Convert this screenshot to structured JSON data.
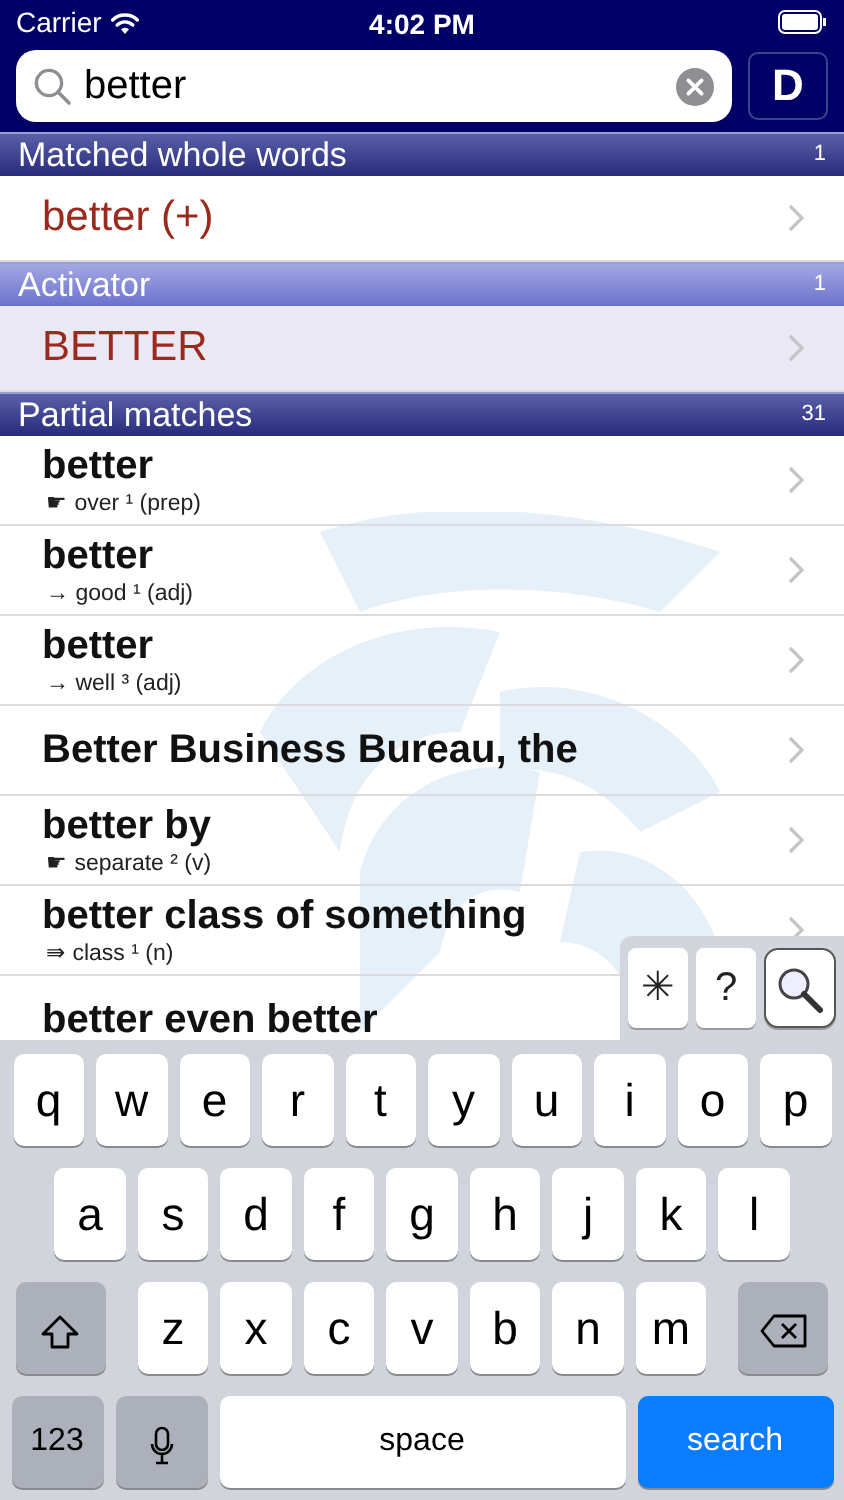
{
  "status_bar": {
    "carrier": "Carrier",
    "time": "4:02 PM"
  },
  "search": {
    "value": "better",
    "button": "D"
  },
  "sections": [
    {
      "title": "Matched whole words",
      "count": "1",
      "kind": "whole",
      "items": [
        {
          "title": "better (+)"
        }
      ]
    },
    {
      "title": "Activator",
      "count": "1",
      "kind": "activator",
      "items": [
        {
          "title": "BETTER"
        }
      ]
    },
    {
      "title": "Partial matches",
      "count": "31",
      "kind": "partial",
      "items": [
        {
          "title": "better",
          "subtitle": "☛ over ¹ (prep)"
        },
        {
          "title": "better",
          "subtitle": "→ good ¹ (adj)"
        },
        {
          "title": "better",
          "subtitle": "→ well ³ (adj)"
        },
        {
          "title": "Better Business Bureau, the"
        },
        {
          "title": "better by",
          "subtitle": "☛ separate ² (v)"
        },
        {
          "title": "better class of something",
          "subtitle": "⇛ class ¹ (n)"
        },
        {
          "title": "better even better"
        }
      ]
    }
  ],
  "search_modes": [
    {
      "kind": "text",
      "label": "✳",
      "selected": false
    },
    {
      "kind": "text",
      "label": "?",
      "selected": false
    },
    {
      "kind": "search",
      "selected": true
    }
  ],
  "keyboard": {
    "rows": [
      [
        "q",
        "w",
        "e",
        "r",
        "t",
        "y",
        "u",
        "i",
        "o",
        "p"
      ],
      [
        "a",
        "s",
        "d",
        "f",
        "g",
        "h",
        "j",
        "k",
        "l"
      ],
      [
        "z",
        "x",
        "c",
        "v",
        "b",
        "n",
        "m"
      ]
    ],
    "numbers": "123",
    "space": "space",
    "action": "search"
  }
}
